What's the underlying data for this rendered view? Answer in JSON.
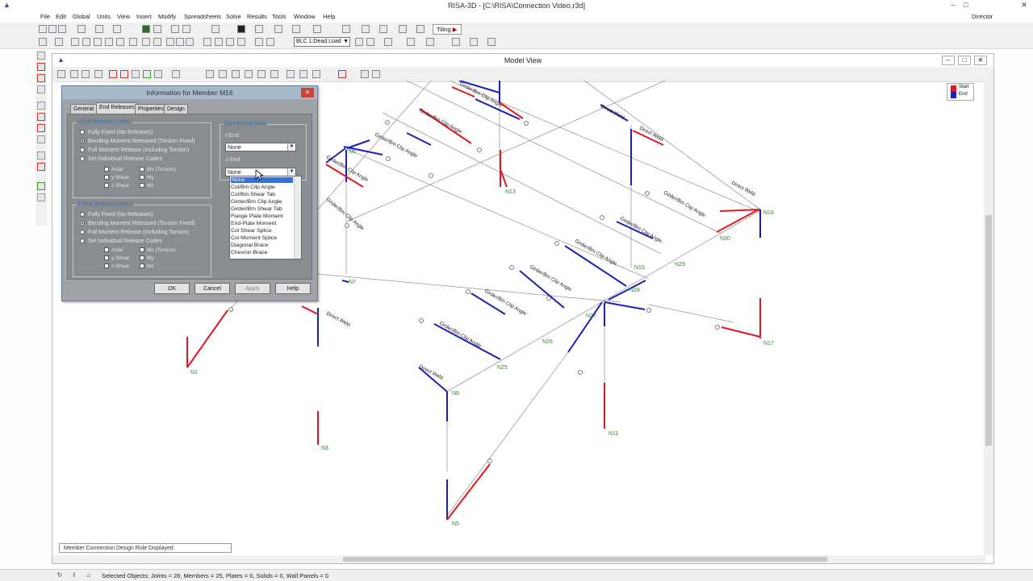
{
  "app": {
    "title": "RISA-3D - [C:\\RISA\\Connection Video.r3d]",
    "user": "Director",
    "window_controls": [
      "–",
      "□",
      "✕"
    ]
  },
  "menu": [
    "File",
    "Edit",
    "Global",
    "Units",
    "View",
    "Insert",
    "Modify",
    "Spreadsheets",
    "Solve",
    "Results",
    "Tools",
    "Window",
    "Help"
  ],
  "toolbar": {
    "tiling_label": "Tiling",
    "load_combo": "BLC 1:Dead Load"
  },
  "model_view": {
    "title": "Model View",
    "legend": {
      "start": "Start",
      "end": "End",
      "start_color": "#e0171f",
      "end_color": "#1a20b8"
    },
    "rule_status": "Member Connection Design Rule Displayed",
    "nodes": [
      "N1",
      "N3",
      "N5",
      "N6",
      "N7",
      "N8",
      "N11",
      "N13",
      "N15",
      "N17",
      "N18",
      "N25",
      "N26",
      "N27",
      "N28",
      "N29",
      "N30"
    ],
    "connection_labels": {
      "gc": "Girder/Bm Clip Angle",
      "dw": "Direct Weld"
    }
  },
  "dialog": {
    "title": "Information for Member M16",
    "tabs": [
      "General",
      "End Releases",
      "Properties",
      "Design"
    ],
    "active_tab": "End Releases",
    "i_group_title": "I-End Release Codes",
    "j_group_title": "J-End Release Codes",
    "release_options": [
      "Fully Fixed (No Releases)",
      "Bending Moment Released (Torsion Fixed)",
      "Full Moment Release (Including Torsion)",
      "Set Individual Release Codes"
    ],
    "i_selected": 1,
    "j_selected": 1,
    "release_checks": [
      "Axial",
      "y Shear",
      "z Shear",
      "Mx (Torsion)",
      "My",
      "Mz"
    ],
    "rule_group_title": "Connection Rule",
    "i_end_label": "I-End",
    "j_end_label": "J-End",
    "i_end_value": "None",
    "j_end_value": "None",
    "dropdown_options": [
      "None",
      "Col/Bm Clip Angle",
      "Col/Bm Shear Tab",
      "Girder/Bm Clip Angle",
      "Girder/Bm Shear Tab",
      "Flange Plate Moment",
      "End-Plate Moment",
      "Col Shear Splice",
      "Col Moment Splice",
      "Diagonal Brace",
      "Chevron Brace"
    ],
    "buttons": {
      "ok": "OK",
      "cancel": "Cancel",
      "apply": "Apply",
      "help": "Help"
    }
  },
  "status": {
    "selected": "Selected Objects: Joints = 28, Members = 25, Plates = 0, Solids = 0, Wall Panels = 0"
  }
}
